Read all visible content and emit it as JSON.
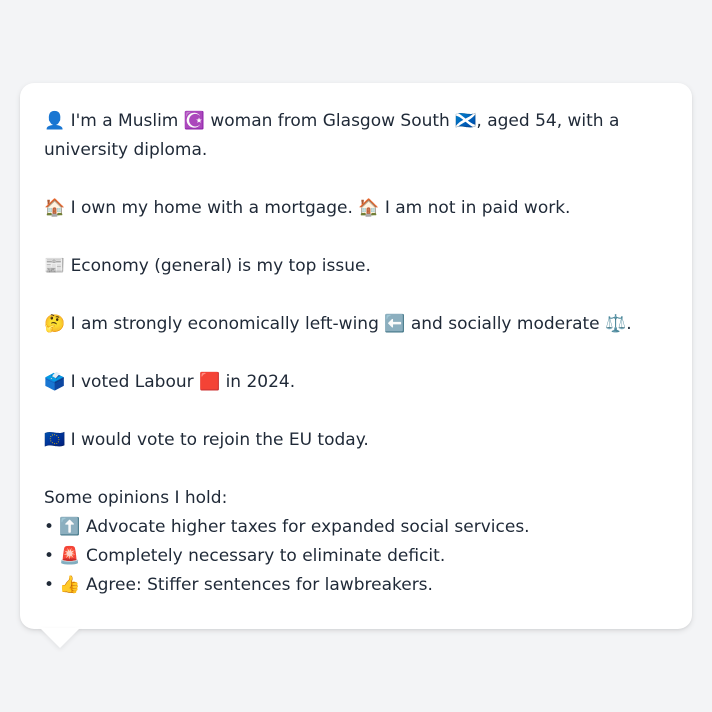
{
  "bio": {
    "intro": "👤 I'm a Muslim ☪️ woman from Glasgow South 🏴󠁧󠁢󠁳󠁣󠁴󠁿, aged 54, with a university diploma.",
    "home": "🏠 I own my home with a mortgage. 🏠 I am not in paid work.",
    "issue": "📰 Economy (general) is my top issue.",
    "politics": "🤔 I am strongly economically left-wing ⬅️ and socially moderate ⚖️.",
    "vote": "🗳️ I voted Labour 🟥 in 2024.",
    "eu": "🇪🇺 I would vote to rejoin the EU today."
  },
  "opinions": {
    "title": "Some opinions I hold:",
    "items": [
      "• ⬆️ Advocate higher taxes for expanded social services.",
      "• 🚨 Completely necessary to eliminate deficit.",
      "• 👍 Agree: Stiffer sentences for lawbreakers."
    ]
  },
  "colors": {
    "background": "#f3f4f6",
    "card": "#ffffff",
    "text": "#1f2937"
  }
}
